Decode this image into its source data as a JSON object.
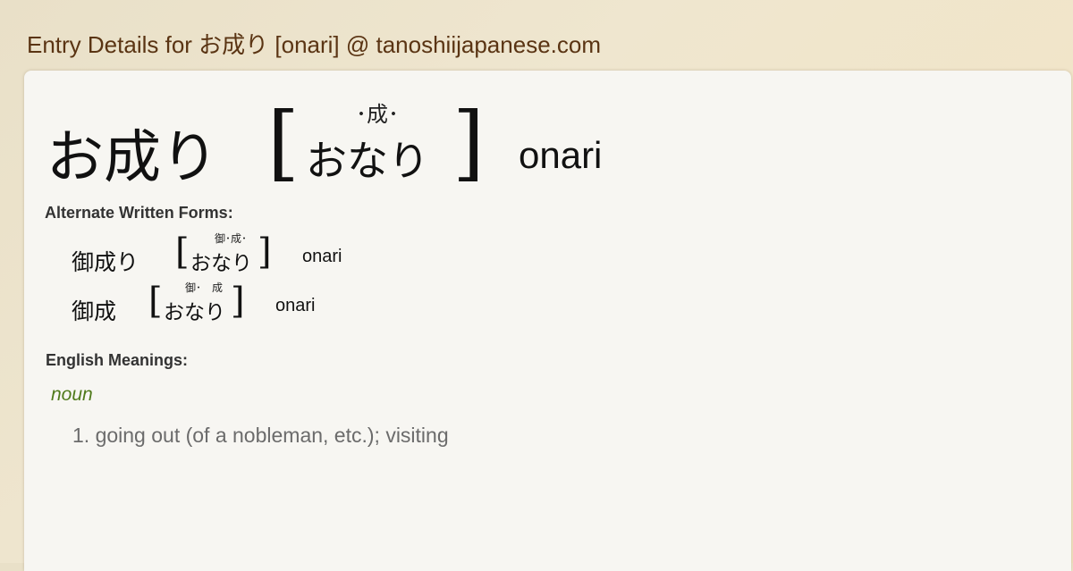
{
  "header": {
    "title": "Entry Details for お成り [onari] @ tanoshiijapanese.com"
  },
  "entry": {
    "kanji": "お成り",
    "bracket_open": "[",
    "bracket_close": "]",
    "furigana": "･成･",
    "reading": "おなり",
    "romaji": "onari"
  },
  "alternate": {
    "label": "Alternate Written Forms:",
    "forms": [
      {
        "kanji": "御成り",
        "furigana": "御･成･",
        "reading": "おなり",
        "romaji": "onari"
      },
      {
        "kanji": "御成",
        "furigana": "御･　成",
        "reading": "おなり",
        "romaji": "onari"
      }
    ]
  },
  "meanings": {
    "label": "English Meanings:",
    "part_of_speech": "noun",
    "items": [
      "1. going out (of a nobleman, etc.); visiting"
    ]
  }
}
